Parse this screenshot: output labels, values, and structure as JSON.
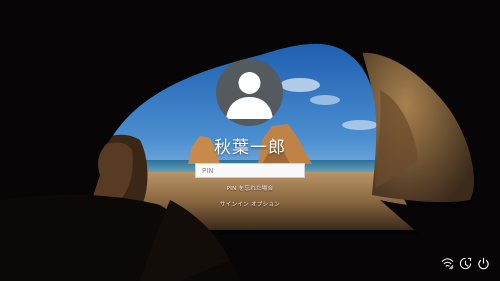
{
  "user": {
    "name": "秋葉一郎"
  },
  "pin_field": {
    "placeholder": "PIN",
    "value": ""
  },
  "links": {
    "forgot_pin": "PIN を忘れた場合",
    "sign_in_options": "サインイン オプション"
  },
  "tray": {
    "icons": [
      "network-icon",
      "ease-of-access-icon",
      "power-icon"
    ]
  },
  "colors": {
    "sky": "#2e6fb7",
    "sea": "#2f7fa8",
    "sand": "#c79a63",
    "cave": "#0a0706",
    "pin_bg": "#f8f8f8"
  }
}
